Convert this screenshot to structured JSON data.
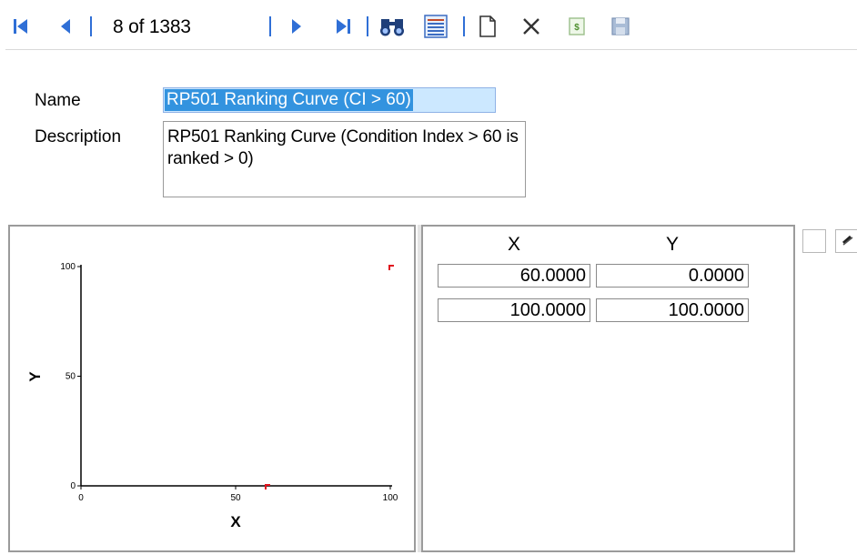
{
  "toolbar": {
    "buttons": [
      {
        "icon": "first-record-icon"
      },
      {
        "icon": "previous-record-icon"
      },
      {
        "icon": "next-record-icon"
      },
      {
        "icon": "last-record-icon"
      },
      {
        "icon": "find-binoculars-icon"
      },
      {
        "icon": "list-view-icon"
      },
      {
        "icon": "new-document-icon"
      },
      {
        "icon": "delete-x-icon"
      },
      {
        "icon": "copy-record-icon"
      },
      {
        "icon": "save-disk-icon"
      }
    ],
    "record_counter": "8 of 1383",
    "accent": "#2f6fd6"
  },
  "form": {
    "name_label": "Name",
    "name_value": "RP501 Ranking Curve (CI > 60)",
    "description_label": "Description",
    "description_value": "RP501 Ranking Curve (Condition Index > 60 is ranked > 0)"
  },
  "chart_data": {
    "type": "scatter",
    "xlabel": "X",
    "ylabel": "Y",
    "xlim": [
      0,
      100
    ],
    "ylim": [
      0,
      100
    ],
    "x_ticks": [
      "0",
      "50",
      "100"
    ],
    "y_ticks": [
      "0",
      "50",
      "100"
    ],
    "points": [
      {
        "x": 60,
        "y": 0
      },
      {
        "x": 100,
        "y": 100
      }
    ],
    "point_color": "#e0141e",
    "grid": false
  },
  "table": {
    "headers": [
      "X",
      "Y"
    ],
    "rows": [
      [
        "60.0000",
        "0.0000"
      ],
      [
        "100.0000",
        "100.0000"
      ]
    ]
  },
  "side_buttons": [
    {
      "icon": "blank-button-icon"
    },
    {
      "icon": "edit-pencil-icon"
    }
  ]
}
